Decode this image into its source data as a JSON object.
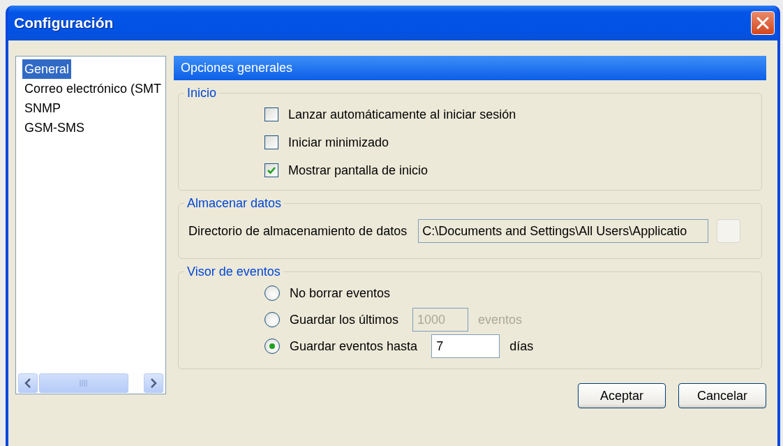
{
  "window": {
    "title": "Configuración"
  },
  "sidebar": {
    "items": [
      {
        "label": "General",
        "selected": true
      },
      {
        "label": "Correo electrónico (SMT",
        "selected": false
      },
      {
        "label": "SNMP",
        "selected": false
      },
      {
        "label": "GSM-SMS",
        "selected": false
      }
    ]
  },
  "panel": {
    "header": "Opciones generales",
    "startup": {
      "legend": "Inicio",
      "checkboxes": [
        {
          "label": "Lanzar automáticamente al iniciar sesión",
          "checked": false
        },
        {
          "label": "Iniciar minimizado",
          "checked": false
        },
        {
          "label": "Mostrar pantalla de inicio",
          "checked": true
        }
      ]
    },
    "storage": {
      "legend": "Almacenar datos",
      "label": "Directorio de almacenamiento de datos",
      "path": "C:\\Documents and Settings\\All Users\\Applicatio"
    },
    "events": {
      "legend": "Visor de eventos",
      "options": [
        {
          "label": "No borrar eventos",
          "selected": false
        },
        {
          "label": "Guardar los últimos",
          "selected": false,
          "field": "1000",
          "suffix": "eventos",
          "disabled": true
        },
        {
          "label": "Guardar eventos hasta",
          "selected": true,
          "field": "7",
          "suffix": "días",
          "disabled": false
        }
      ]
    }
  },
  "buttons": [
    "Aceptar",
    "Cancelar"
  ]
}
